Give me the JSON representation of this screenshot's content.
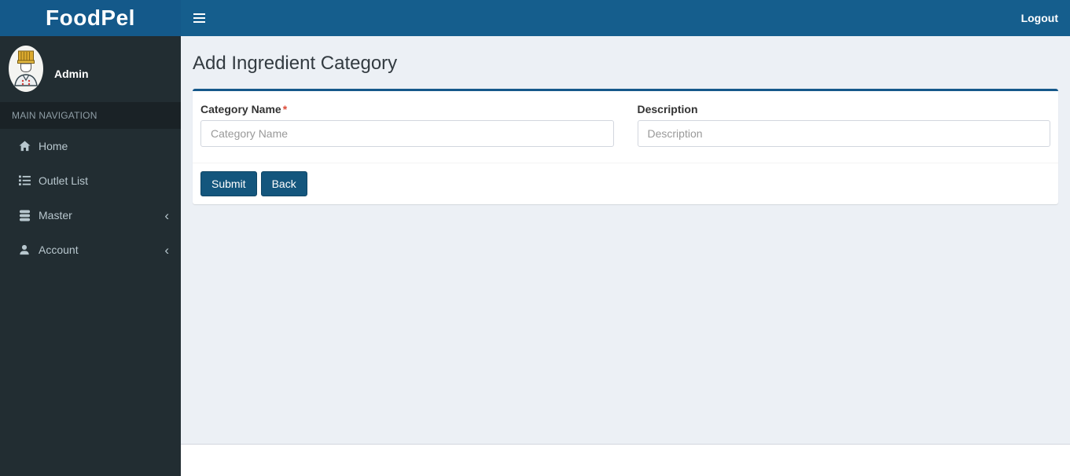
{
  "navbar": {
    "brand": "FoodPel",
    "logout_label": "Logout"
  },
  "sidebar": {
    "user": {
      "name": "Admin",
      "avatar_icon": "chef-avatar-icon"
    },
    "section_header": "MAIN NAVIGATION",
    "items": [
      {
        "label": "Home",
        "icon": "home-icon",
        "has_submenu": false
      },
      {
        "label": "Outlet List",
        "icon": "list-icon",
        "has_submenu": false
      },
      {
        "label": "Master",
        "icon": "database-icon",
        "has_submenu": true
      },
      {
        "label": "Account",
        "icon": "user-icon",
        "has_submenu": true
      }
    ]
  },
  "icons": {
    "chevron_left": "‹"
  },
  "main": {
    "title": "Add Ingredient Category",
    "form": {
      "required_marker": "*",
      "fields": [
        {
          "label": "Category Name",
          "required": true,
          "placeholder": "Category Name",
          "value": ""
        },
        {
          "label": "Description",
          "required": false,
          "placeholder": "Description",
          "value": ""
        }
      ],
      "submit_label": "Submit",
      "back_label": "Back"
    }
  },
  "colors": {
    "primary": "#155e8d",
    "button": "#14567d",
    "sidebar_bg": "#222d32",
    "sidebar_header_bg": "#1a2226",
    "sidebar_text": "#b8c7ce",
    "content_bg": "#ecf0f5",
    "card_top_border": "#15588a",
    "required": "#dd4b39",
    "input_border": "#d2d6de",
    "placeholder": "#999999"
  }
}
